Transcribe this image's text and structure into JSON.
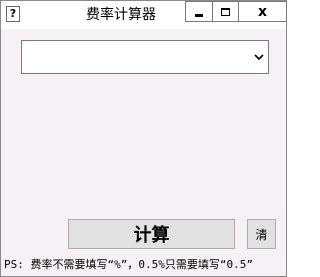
{
  "window": {
    "title": "费率计算器",
    "app_icon_glyph": "?",
    "controls": {
      "minimize": "minimize",
      "maximize": "maximize",
      "close": "x"
    }
  },
  "dropdown": {
    "value": ""
  },
  "buttons": {
    "calculate_label": "计算",
    "clear_label": "清"
  },
  "hint_text": "PS: 费率不需要填写“%”，0.5%只需要填写“0.5”"
}
